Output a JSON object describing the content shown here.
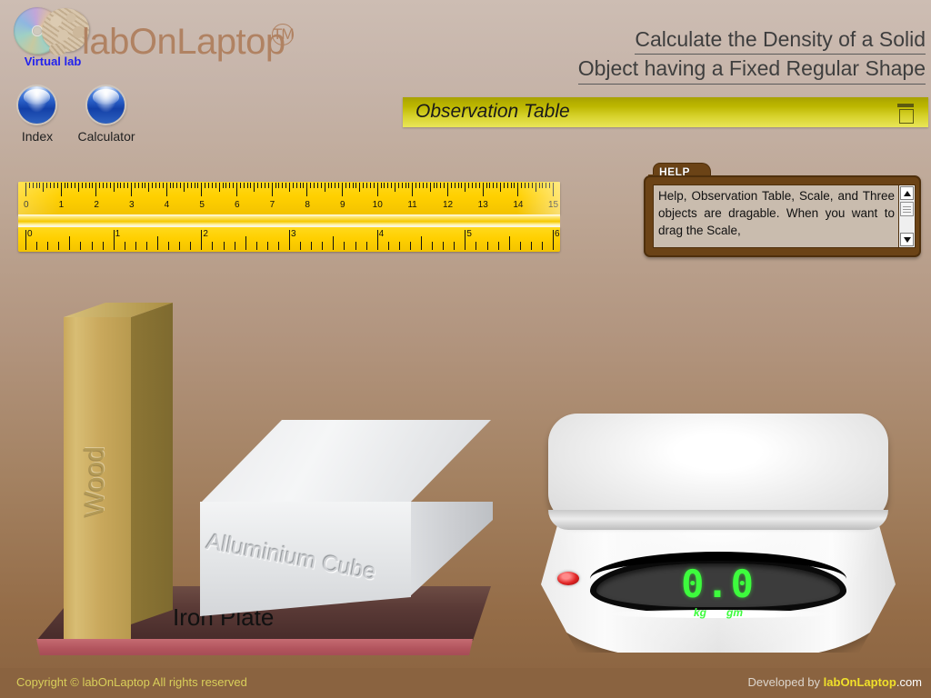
{
  "header": {
    "logo_caption": "Virtual lab",
    "brand": "labOnLaptop",
    "trademark": "TM",
    "buttons": [
      {
        "label": "Index",
        "icon": "blue-orb-icon"
      },
      {
        "label": "Calculator",
        "icon": "blue-orb-icon"
      }
    ],
    "title_line1": "Calculate the Density of a Solid",
    "title_line2": "Object having a Fixed Regular Shape"
  },
  "observation": {
    "label": "Observation Table",
    "icon": "table-window-icon"
  },
  "ruler": {
    "cm_labels": [
      "0",
      "1",
      "2",
      "3",
      "4",
      "5",
      "6",
      "7",
      "8",
      "9",
      "10",
      "11",
      "12",
      "13",
      "14",
      "15"
    ],
    "inch_labels": [
      "0",
      "1",
      "2",
      "3",
      "4",
      "5",
      "6"
    ],
    "cm_max": 15,
    "inch_max": 6
  },
  "help": {
    "tab_label": "HELP",
    "body": "Help, Observation Table, Scale, and Three objects are dragable. When you want to drag the Scale,",
    "scroll_up_icon": "triangle-up-icon",
    "scroll_down_icon": "triangle-down-icon"
  },
  "objects": {
    "wood_label": "Wood",
    "cube_label": "Alluminium Cube",
    "plate_label": "Iron Plate"
  },
  "scale": {
    "reading": "0.0",
    "unit_kg": "kg",
    "unit_gm": "gm",
    "led": "power-led-icon"
  },
  "footer": {
    "copyright": "Copyright © labOnLaptop All rights reserved",
    "developed_prefix": "Developed by ",
    "developed_brand": "labOnLaptop",
    "developed_tld": ".com"
  },
  "colors": {
    "brand": "#b08262",
    "accent_bar": "#d6d12a",
    "help_frame": "#6b4316",
    "lcd_green": "#3dfc3d",
    "footer_bg": "#8a6340",
    "link_blue": "#2222ee"
  }
}
